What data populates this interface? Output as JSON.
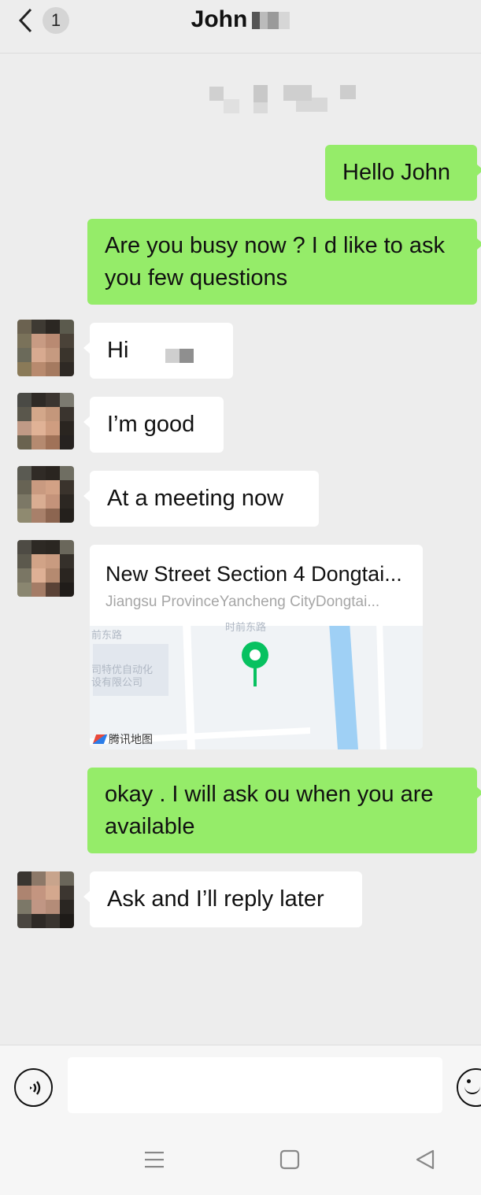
{
  "header": {
    "title": "John",
    "unread_count": "1"
  },
  "messages": [
    {
      "side": "out",
      "text": "Hello John"
    },
    {
      "side": "out",
      "text_line1": "Are you busy now ? I d like to ask",
      "text_line2": "you few questions"
    },
    {
      "side": "in",
      "text": "Hi"
    },
    {
      "side": "in",
      "text": "I’m good"
    },
    {
      "side": "in",
      "text": "At a meeting now"
    },
    {
      "side": "in",
      "type": "location",
      "title": "New Street Section 4 Dongtai...",
      "subtitle": "Jiangsu ProvinceYancheng CityDongtai...",
      "map_labels": [
        "前东路",
        "时前东路",
        "司特优自动化",
        "设有限公司"
      ],
      "map_provider": "腾讯地图"
    },
    {
      "side": "out",
      "text_line1": "okay . I will ask ou when you are",
      "text_line2": "available"
    },
    {
      "side": "in",
      "text": "Ask and I’ll reply later"
    }
  ],
  "colors": {
    "outgoing_bubble": "#95ec69",
    "incoming_bubble": "#ffffff",
    "background": "#ededed",
    "map_pin": "#07c160",
    "map_river": "#9fd0f5"
  },
  "icons": {
    "back": "chevron-left-icon",
    "voice": "voice-input-icon",
    "emoji": "emoji-icon",
    "nav_menu": "menu-icon",
    "nav_home": "home-square-icon",
    "nav_back": "back-triangle-icon"
  }
}
